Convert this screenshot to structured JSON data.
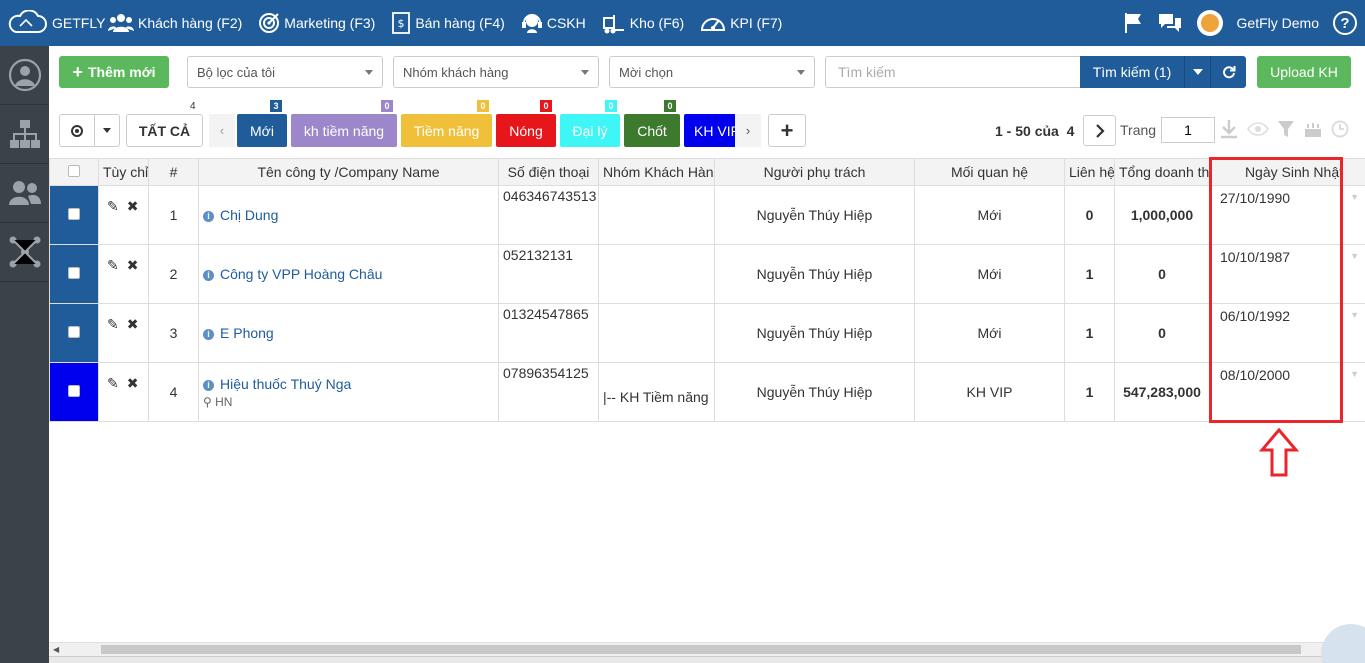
{
  "nav": {
    "brand": "GETFLY",
    "items": [
      {
        "label": "Khách hàng (F2)",
        "icon": "customers-icon"
      },
      {
        "label": "Marketing (F3)",
        "icon": "target-icon"
      },
      {
        "label": "Bán hàng (F4)",
        "icon": "sales-document-icon"
      },
      {
        "label": "CSKH",
        "icon": "headset-icon"
      },
      {
        "label": "Kho (F6)",
        "icon": "forklift-icon"
      },
      {
        "label": "KPI (F7)",
        "icon": "speedometer-icon"
      }
    ],
    "user_name": "GetFly Demo",
    "help": "?"
  },
  "toolbar": {
    "add_label": "Thêm mới",
    "filter_select": "Bộ lọc của tôi",
    "group_select": "Nhóm khách hàng",
    "invite_select": "Mời chọn",
    "search_placeholder": "Tìm kiếm",
    "search_button": "Tìm kiếm (1)",
    "upload_button": "Upload KH"
  },
  "tags": {
    "all_label": "TẤT CẢ",
    "all_count": "4",
    "items": [
      {
        "label": "Mới",
        "count": "3",
        "color": "#1f5c99",
        "count_color": "#1f5c99"
      },
      {
        "label": "kh tiềm năng",
        "count": "0",
        "color": "#9b87c9",
        "count_color": "#9b87c9"
      },
      {
        "label": "Tiềm năng",
        "count": "0",
        "color": "#f0c03a",
        "count_color": "#f0c03a"
      },
      {
        "label": "Nóng",
        "count": "0",
        "color": "#e6161b",
        "count_color": "#e6161b"
      },
      {
        "label": "Đại lý",
        "count": "0",
        "color": "#3ff5f5",
        "count_color": "#3ff5f5"
      },
      {
        "label": "Chốt",
        "count": "0",
        "color": "#3d7a2e",
        "count_color": "#3d7a2e"
      },
      {
        "label": "KH VIP",
        "count": "",
        "color": "#0000ee",
        "count_color": "#0000ee"
      }
    ]
  },
  "pager": {
    "range_text": "1 - 50 của",
    "total": "4",
    "page_label": "Trang",
    "page_value": "1"
  },
  "table": {
    "headers": [
      "Tùy chỉnh",
      "#",
      "Tên công ty /Company Name",
      "Số điện thoại",
      "Nhóm Khách Hàng",
      "Người phụ trách",
      "Mối quan hệ",
      "Liên hệ",
      "Tổng doanh thu",
      "Ngày Sinh Nhật"
    ],
    "rows": [
      {
        "num": "1",
        "name": "Chị Dung",
        "address": "",
        "phone": "046346743513",
        "group": "",
        "owner": "Nguyễn Thúy Hiệp",
        "relation": "Mới",
        "contacts": "0",
        "revenue": "1,000,000",
        "birthday": "27/10/1990",
        "color": "#1f5c99"
      },
      {
        "num": "2",
        "name": "Công ty VPP Hoàng Châu",
        "address": "",
        "phone": "052132131",
        "group": "",
        "owner": "Nguyễn Thúy Hiệp",
        "relation": "Mới",
        "contacts": "1",
        "revenue": "0",
        "birthday": "10/10/1987",
        "color": "#1f5c99"
      },
      {
        "num": "3",
        "name": "E Phong",
        "address": "",
        "phone": "01324547865",
        "group": "",
        "owner": "Nguyễn Thúy Hiệp",
        "relation": "Mới",
        "contacts": "1",
        "revenue": "0",
        "birthday": "06/10/1992",
        "color": "#1f5c99"
      },
      {
        "num": "4",
        "name": "Hiệu thuốc Thuý Nga",
        "address": "HN",
        "phone": "07896354125",
        "group": "|-- KH Tiềm năng",
        "owner": "Nguyễn Thúy Hiệp",
        "relation": "KH VIP",
        "contacts": "1",
        "revenue": "547,283,000",
        "birthday": "08/10/2000",
        "color": "#0000ee"
      }
    ]
  },
  "colors": {
    "nav_bg": "#1f5c99",
    "sidebar_bg": "#3b4248",
    "green": "#5cb85c",
    "highlight": "#e8262b"
  }
}
